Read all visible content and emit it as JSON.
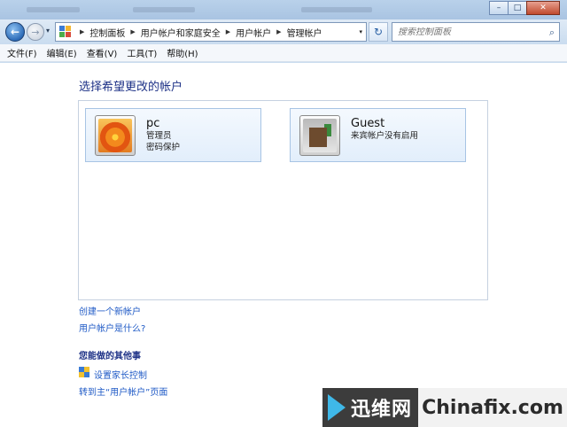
{
  "window": {
    "controls": {
      "minimize": "–",
      "maximize": "□",
      "close": "✕"
    }
  },
  "nav": {
    "back_icon": "←",
    "forward_icon": "→",
    "dropdown_icon": "▾",
    "breadcrumbs": [
      "控制面板",
      "用户帐户和家庭安全",
      "用户帐户",
      "管理帐户"
    ],
    "refresh_icon": "↻",
    "search_placeholder": "搜索控制面板",
    "search_icon": "⌕"
  },
  "menu": [
    "文件(F)",
    "编辑(E)",
    "查看(V)",
    "工具(T)",
    "帮助(H)"
  ],
  "page": {
    "title": "选择希望更改的帐户",
    "accounts": [
      {
        "name": "pc",
        "role": "管理员",
        "status": "密码保护"
      },
      {
        "name": "Guest",
        "role": "来宾帐户没有启用",
        "status": ""
      }
    ],
    "links": {
      "create_account": "创建一个新帐户",
      "what_is_account": "用户帐户是什么?"
    },
    "other_section": {
      "heading": "您能做的其他事",
      "parental_controls": "设置家长控制",
      "go_main": "转到主“用户帐户”页面"
    }
  },
  "watermark": {
    "cn": "迅维网",
    "en": "Chinafix.com"
  },
  "colors": {
    "title_blue": "#1e3287",
    "link_blue": "#1f5ac6",
    "tile_border": "#a7c4e4"
  }
}
